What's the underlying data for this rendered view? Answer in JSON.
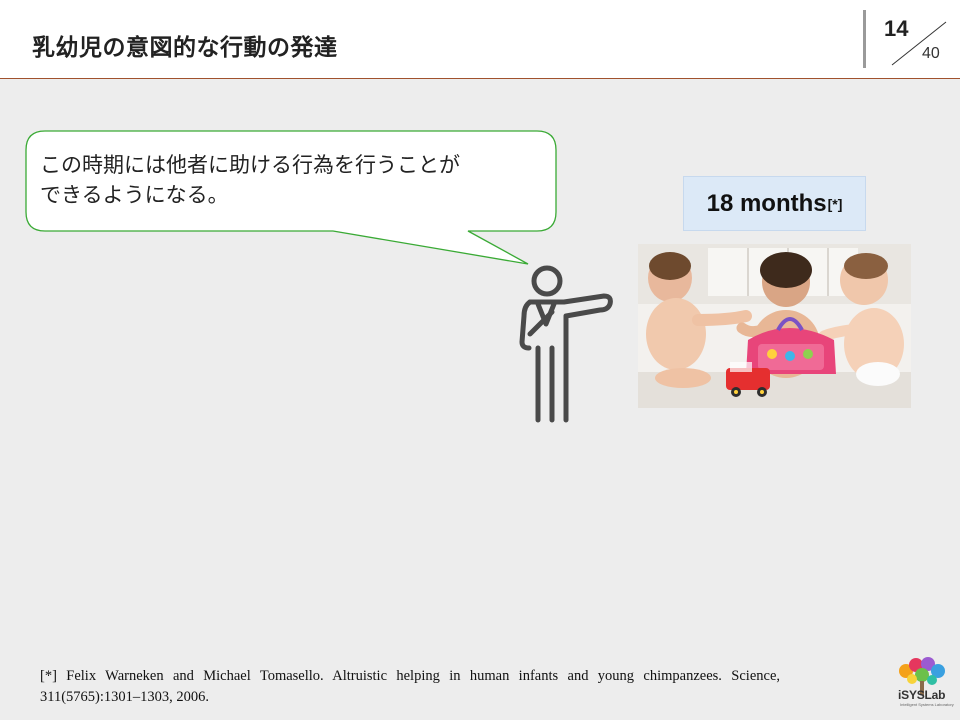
{
  "header": {
    "title": "乳幼児の意図的な行動の発達",
    "page_current": "14",
    "page_total": "40"
  },
  "bubble": {
    "text_line1": "この時期には他者に助ける行為を行うことが",
    "text_line2": "できるようになる。",
    "border_color": "#3aaa35"
  },
  "months": {
    "label": "18 months",
    "ref": "[*]"
  },
  "photo": {
    "description_icon": "babies-playing-photo"
  },
  "citation": {
    "text": "[*] Felix Warneken and Michael Tomasello. Altruistic helping in human infants and young chimpanzees. Science, 311(5765):1301–1303, 2006."
  },
  "logo": {
    "text": "iSYSLab",
    "subtext": "Intelligent Systems Laboratory"
  },
  "colors": {
    "header_rule": "#a0522d",
    "background": "#ededed",
    "months_box": "#dce9f7"
  }
}
